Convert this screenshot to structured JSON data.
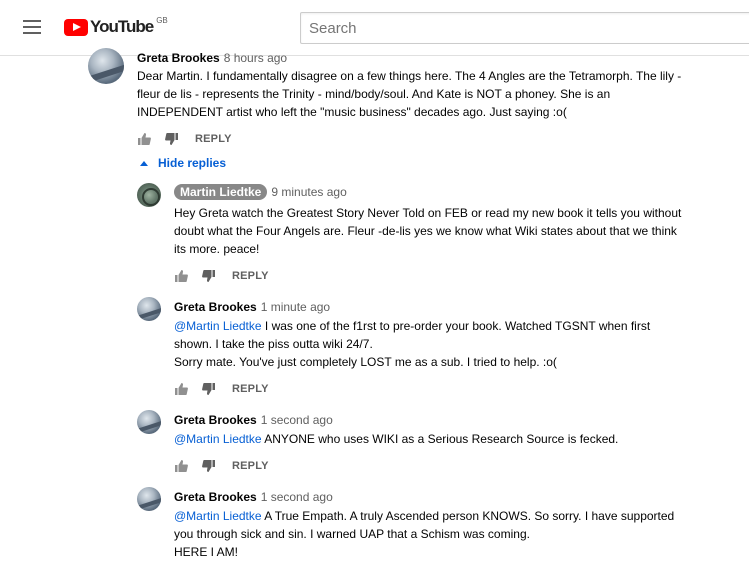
{
  "header": {
    "logo_text": "YouTube",
    "region": "GB",
    "search_placeholder": "Search"
  },
  "top_comment": {
    "author": "Greta Brookes",
    "time": "8 hours ago",
    "text": "Dear Martin. I fundamentally disagree on a few things here. The 4 Angles are the Tetramorph. The lily -\nfleur de lis - represents the Trinity - mind/body/soul. And Kate is NOT a phoney. She is an\nINDEPENDENT artist who left the \"music business\" decades ago. Just saying :o(",
    "reply_label": "REPLY",
    "hide_replies_label": "Hide replies"
  },
  "replies": [
    {
      "author": "Martin Liedtke",
      "time": "9 minutes ago",
      "mention": "",
      "text": "Hey Greta watch the Greatest Story Never Told on FEB or read my new book it tells you without\ndoubt what the Four Angels are. Fleur -de-lis yes we know what Wiki states about that we think\nits more. peace!",
      "reply_label": "REPLY"
    },
    {
      "author": "Greta Brookes",
      "time": "1 minute ago",
      "mention": "@Martin Liedtke",
      "text": " I was one of the f1rst to pre-order your book. Watched TGSNT when first\nshown. I take the piss outta wiki 24/7.\nSorry mate. You've just completely LOST me as a sub. I tried to help. :o(",
      "reply_label": "REPLY"
    },
    {
      "author": "Greta Brookes",
      "time": "1 second ago",
      "mention": "@Martin Liedtke",
      "text": " ANYONE who uses WIKI as a Serious Research Source is fecked.",
      "reply_label": "REPLY"
    },
    {
      "author": "Greta Brookes",
      "time": "1 second ago",
      "mention": "@Martin Liedtke",
      "text": " A True Empath. A truly Ascended person KNOWS. So sorry. I have supported\nyou through  sick  and sin. I warned UAP that a Schism was coming.\nHERE I AM!",
      "reply_label": ""
    }
  ],
  "colors": {
    "link": "#065fd4",
    "brand": "#ff0000",
    "meta": "#606060"
  }
}
